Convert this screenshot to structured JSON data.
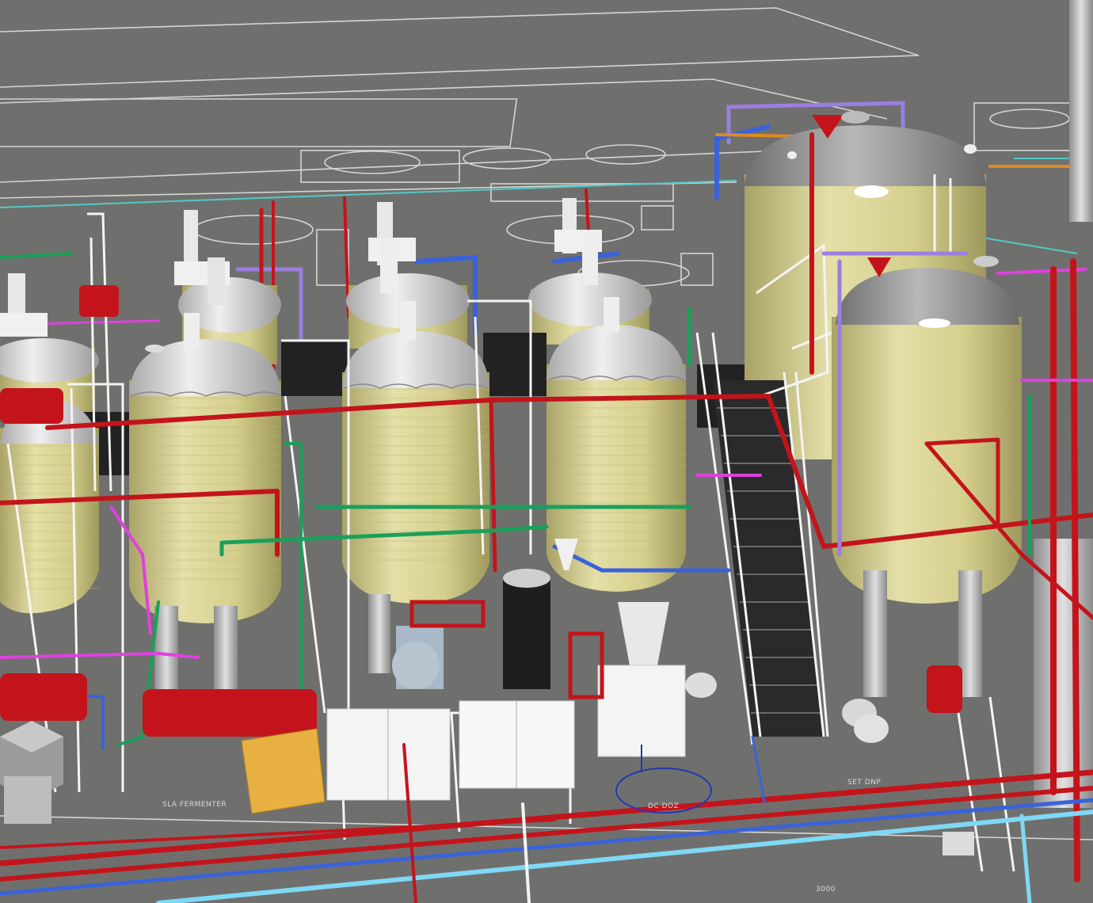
{
  "viewport": {
    "background": "#6f706d",
    "floor_line_color": "#e8e8e8",
    "grid_line_color": "#54c8c8"
  },
  "colors": {
    "tank_body": "#dcd79a",
    "tank_body_shade": "#b6b070",
    "tank_head": "#d9d9d9",
    "tank_head_dark": "#8f8f8f",
    "pipe_red": "#c4141b",
    "pipe_blue": "#3a63d9",
    "pipe_light_blue": "#7fd8f5",
    "pipe_green": "#1aa05a",
    "pipe_purple": "#9a7fe0",
    "pipe_magenta": "#e040e0",
    "pipe_orange": "#e08a20",
    "structure_white": "#f4f4f4",
    "stair_dark": "#2a2a2a",
    "yellow_box": "#e8b040"
  },
  "icons": {
    "tank": "cylinder-tank-icon",
    "stairs": "staircase-icon",
    "pump": "pump-icon",
    "valve": "valve-icon"
  },
  "floor_labels": {
    "left_text": "SLA FERMENTER",
    "center_text": "DC DOZ",
    "bottom_text": "3000",
    "right_text": "SET DNP"
  }
}
